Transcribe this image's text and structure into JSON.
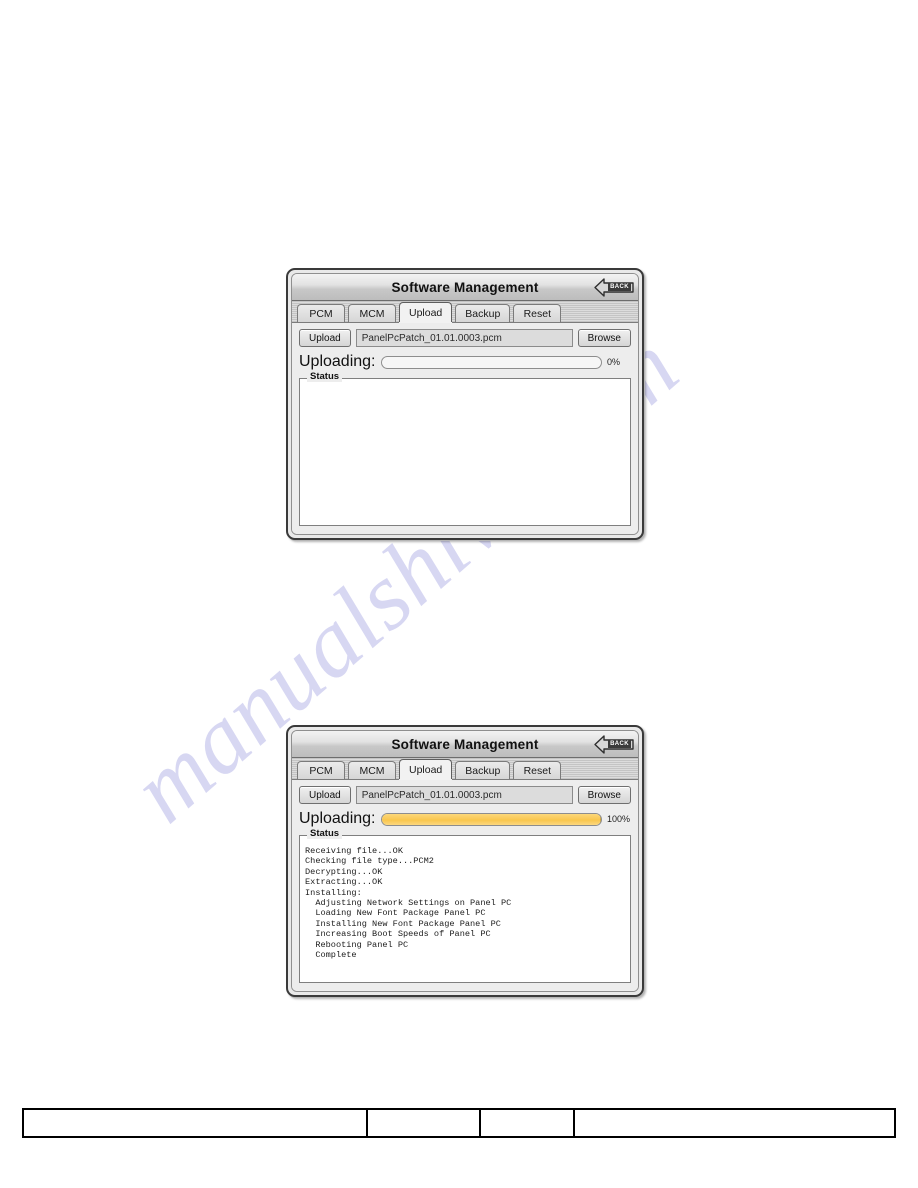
{
  "page": {
    "background_color": "#ffffff",
    "watermark_text": "manualshive.com",
    "watermark_color": "#c9c9ee"
  },
  "dialogs": [
    {
      "title": "Software Management",
      "back_button_label": "BACK",
      "tabs": [
        {
          "label": "PCM",
          "active": false
        },
        {
          "label": "MCM",
          "active": false
        },
        {
          "label": "Upload",
          "active": true
        },
        {
          "label": "Backup",
          "active": false
        },
        {
          "label": "Reset",
          "active": false
        }
      ],
      "upload_button_label": "Upload",
      "file_name": "PanelPcPatch_01.01.0003.pcm",
      "browse_button_label": "Browse",
      "progress_label": "Uploading:",
      "progress_percent": 0,
      "progress_percent_text": "0%",
      "progress_fill_color": "#f9c64e",
      "status_legend": "Status",
      "status_lines": []
    },
    {
      "title": "Software Management",
      "back_button_label": "BACK",
      "tabs": [
        {
          "label": "PCM",
          "active": false
        },
        {
          "label": "MCM",
          "active": false
        },
        {
          "label": "Upload",
          "active": true
        },
        {
          "label": "Backup",
          "active": false
        },
        {
          "label": "Reset",
          "active": false
        }
      ],
      "upload_button_label": "Upload",
      "file_name": "PanelPcPatch_01.01.0003.pcm",
      "browse_button_label": "Browse",
      "progress_label": "Uploading:",
      "progress_percent": 100,
      "progress_percent_text": "100%",
      "progress_fill_color": "#f9c64e",
      "status_legend": "Status",
      "status_lines": [
        "Receiving file...OK",
        "Checking file type...PCM2",
        "Decrypting...OK",
        "Extracting...OK",
        "Installing:",
        "  Adjusting Network Settings on Panel PC",
        "  Loading New Font Package Panel PC",
        "  Installing New Font Package Panel PC",
        "  Increasing Boot Speeds of Panel PC",
        "  Rebooting Panel PC",
        "  Complete"
      ]
    }
  ],
  "footer": {
    "cells": [
      "",
      "",
      "",
      ""
    ]
  }
}
